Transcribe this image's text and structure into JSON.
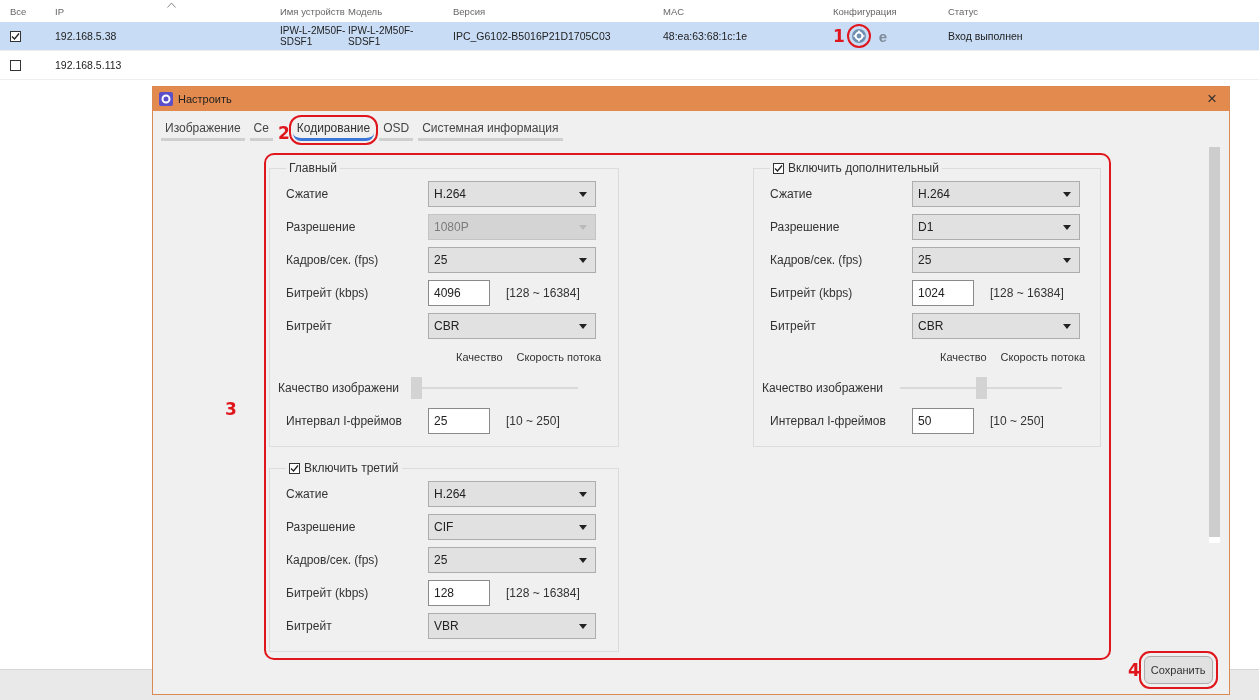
{
  "table": {
    "columns": [
      {
        "label": "Все"
      },
      {
        "label": "IP",
        "sorted": true
      },
      {
        "label": "Имя устройств"
      },
      {
        "label": "Модель"
      },
      {
        "label": "Версия"
      },
      {
        "label": "MAC"
      },
      {
        "label": "Конфигурация"
      },
      {
        "label": "Статус"
      }
    ],
    "rows": [
      {
        "checked": true,
        "selected": true,
        "ip": "192.168.5.38",
        "name": "IPW-L-2M50F-SDSF1",
        "model": "IPW-L-2M50F-SDSF1",
        "version": "IPC_G6102-B5016P21D1705C03",
        "mac": "48:ea:63:68:1c:1e",
        "config": {
          "callout": "1",
          "highlighted": true,
          "browser_icon": "e"
        },
        "status": "Вход выполнен"
      },
      {
        "checked": false,
        "selected": false,
        "ip": "192.168.5.113"
      }
    ]
  },
  "dialog": {
    "title": "Настроить",
    "close": "×",
    "tabs": [
      {
        "label": "Изображение",
        "selected": false,
        "highlighted": false
      },
      {
        "label": "Се",
        "selected": false,
        "highlighted": false
      },
      {
        "label": "Кодирование",
        "selected": true,
        "highlighted": true,
        "callout": "2"
      },
      {
        "label": "OSD",
        "selected": false,
        "highlighted": false
      },
      {
        "label": "Системная информация",
        "selected": false,
        "highlighted": false
      }
    ],
    "settings": {
      "callout": "3",
      "highlighted": true,
      "left": [
        {
          "kind": "plain",
          "title": "Главный",
          "rows": [
            {
              "kind": "select",
              "label": "Сжатие",
              "value": "H.264",
              "disabled": false
            },
            {
              "kind": "select",
              "label": "Разрешение",
              "value": "1080P",
              "disabled": true
            },
            {
              "kind": "select",
              "label": "Кадров/сек. (fps)",
              "value": "25",
              "disabled": false
            },
            {
              "kind": "input",
              "label": "Битрейт (kbps)",
              "value": "4096",
              "range": "[128 ~ 16384]"
            },
            {
              "kind": "select",
              "label": "Битрейт",
              "value": "CBR",
              "disabled": false
            },
            {
              "kind": "slider",
              "captions": [
                "Качество",
                "Скорость потока"
              ],
              "label": "Качество изображени",
              "level": 0
            },
            {
              "kind": "input",
              "label": "Интервал I-фреймов",
              "value": "25",
              "range": "[10 ~ 250]"
            }
          ]
        },
        {
          "kind": "toggle",
          "title": "Включить третий",
          "checked": true,
          "rows": [
            {
              "kind": "select",
              "label": "Сжатие",
              "value": "H.264",
              "disabled": false
            },
            {
              "kind": "select",
              "label": "Разрешение",
              "value": "CIF",
              "disabled": false
            },
            {
              "kind": "select",
              "label": "Кадров/сек. (fps)",
              "value": "25",
              "disabled": false
            },
            {
              "kind": "input",
              "label": "Битрейт (kbps)",
              "value": "128",
              "range": "[128 ~ 16384]"
            },
            {
              "kind": "select",
              "label": "Битрейт",
              "value": "VBR",
              "disabled": false
            }
          ]
        }
      ],
      "right": [
        {
          "kind": "toggle",
          "title": "Включить дополнительный",
          "checked": true,
          "rows": [
            {
              "kind": "select",
              "label": "Сжатие",
              "value": "H.264",
              "disabled": false
            },
            {
              "kind": "select",
              "label": "Разрешение",
              "value": "D1",
              "disabled": false
            },
            {
              "kind": "select",
              "label": "Кадров/сек. (fps)",
              "value": "25",
              "disabled": false
            },
            {
              "kind": "input",
              "label": "Битрейт (kbps)",
              "value": "1024",
              "range": "[128 ~ 16384]"
            },
            {
              "kind": "select",
              "label": "Битрейт",
              "value": "CBR",
              "disabled": false
            },
            {
              "kind": "slider",
              "captions": [
                "Качество",
                "Скорость потока"
              ],
              "label": "Качество изображени",
              "level": 0.5
            },
            {
              "kind": "input",
              "label": "Интервал I-фреймов",
              "value": "50",
              "range": "[10 ~ 250]"
            }
          ]
        }
      ]
    },
    "save_button": {
      "label": "Сохранить",
      "callout": "4",
      "highlighted": true
    }
  }
}
